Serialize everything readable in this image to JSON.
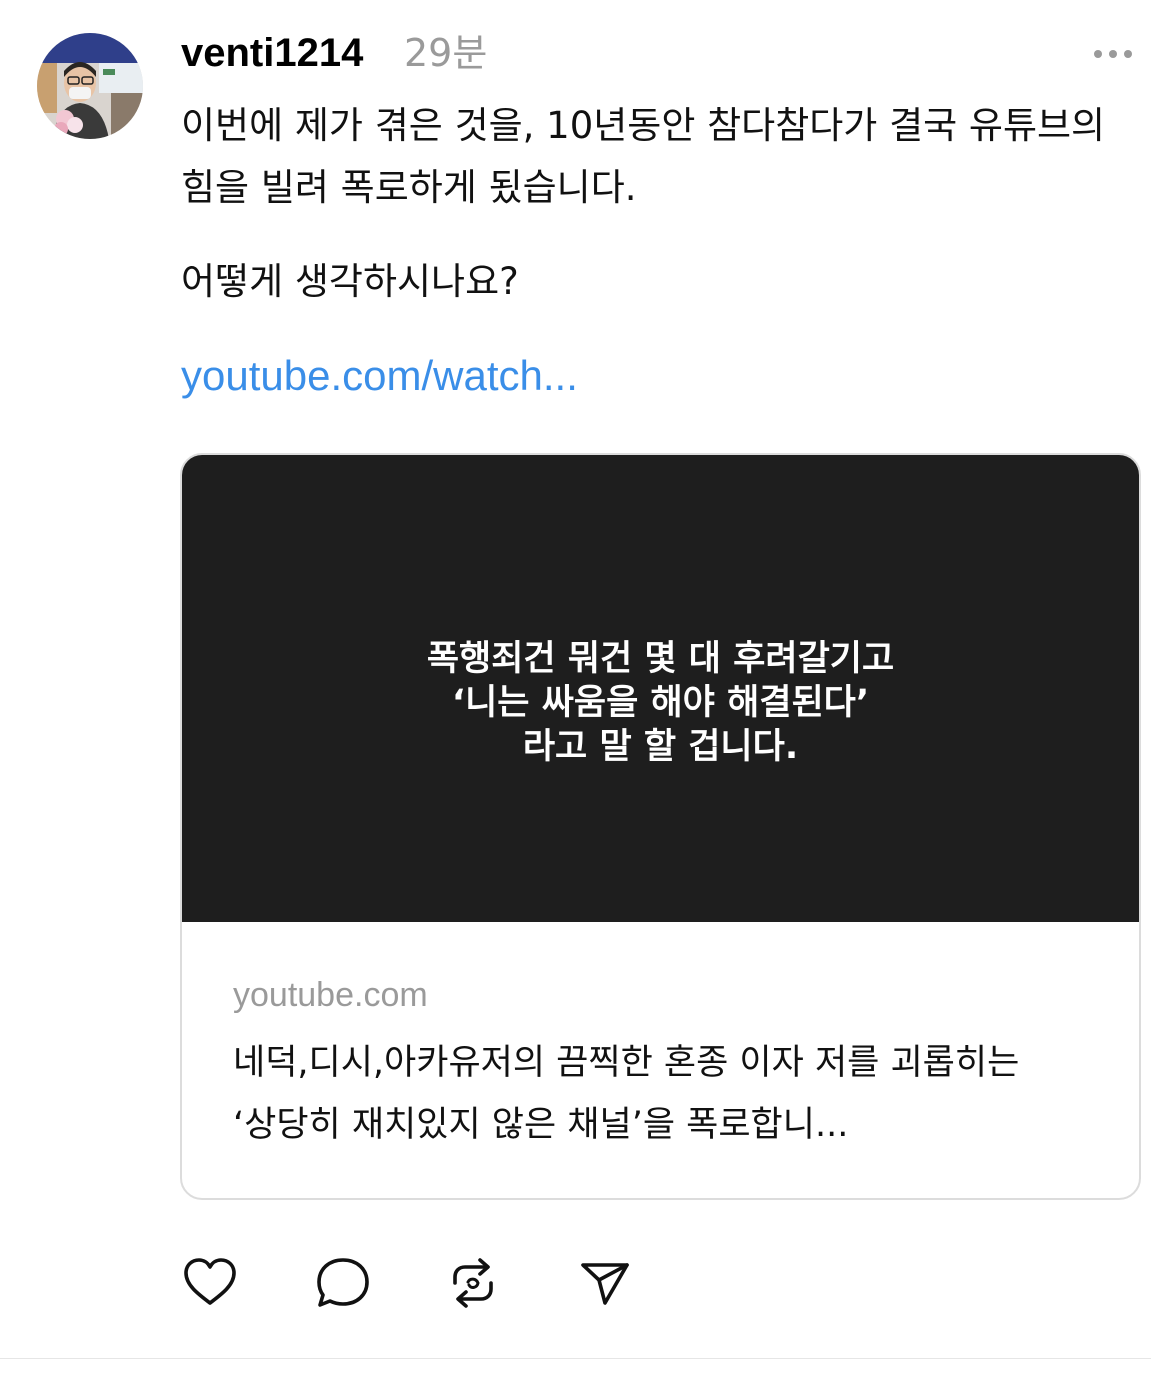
{
  "post": {
    "username": "venti1214",
    "time_ago": "29분",
    "paragraphs": [
      "이번에 제가 겪은 것을, 10년동안 참다참다가 결국 유튜브의 힘을 빌려 폭로하게 됬습니다.",
      "어떻게 생각하시나요?"
    ],
    "link_text": "youtube.com/watch..."
  },
  "card": {
    "thumbnail_lines": [
      "폭행죄건 뭐건 몇 대 후려갈기고",
      "‘니는 싸움을 해야 해결된다’",
      "라고 말 할 겁니다."
    ],
    "domain": "youtube.com",
    "title": "네덕,디시,아카유저의 끔찍한 혼종 이자 저를 괴롭히는 ‘상당히 재치있지 않은 채널’을 폭로합니..."
  },
  "actions": {
    "icons": [
      "heart-icon",
      "comment-icon",
      "repost-icon",
      "share-icon"
    ]
  },
  "colors": {
    "link": "#3a8ee8",
    "muted": "#9a9a9a",
    "thumbnail_bg": "#1e1e1e",
    "border": "#dcdcdc"
  }
}
